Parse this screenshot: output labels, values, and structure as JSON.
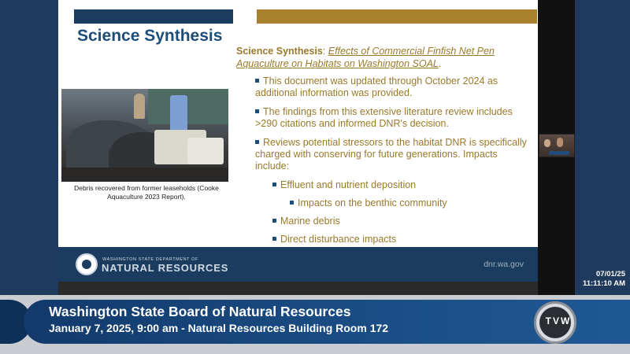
{
  "slide": {
    "title": "Science Synthesis",
    "heading_bold": "Science Synthesis",
    "heading_colon": ": ",
    "heading_link": "Effects of Commercial Finfish Net Pen Aquaculture on Habitats on Washington SOAL",
    "heading_end": ".",
    "photo_caption": "Debris recovered from former leaseholds (Cooke Aquaculture 2023 Report).",
    "bullets": [
      {
        "text": "This document was updated through October 2024 as additional information was provided."
      },
      {
        "text": "The findings from this extensive literature review includes >290 citations and informed DNR's decision."
      },
      {
        "text": "Reviews potential stressors to the habitat DNR is specifically charged with conserving for future generations. Impacts include:"
      },
      {
        "text": "Effluent and nutrient deposition"
      },
      {
        "text": "Impacts on the benthic community"
      },
      {
        "text": "Marine debris"
      },
      {
        "text": "Direct disturbance impacts"
      }
    ],
    "footer": {
      "agency_small": "WASHINGTON STATE DEPARTMENT OF",
      "agency_big": "NATURAL RESOURCES",
      "url": "dnr.wa.gov"
    }
  },
  "broadcast": {
    "date": "07/01/25",
    "time": "11:11:10 AM",
    "title": "Washington State Board of Natural Resources",
    "subtitle": "January 7, 2025, 9:00 am - Natural Resources Building Room 172",
    "channel": "TVW"
  },
  "colors": {
    "navy": "#1b3c5e",
    "gold": "#a9812f",
    "title_blue": "#1d4e7a",
    "text_gold": "#9a7a2a"
  }
}
